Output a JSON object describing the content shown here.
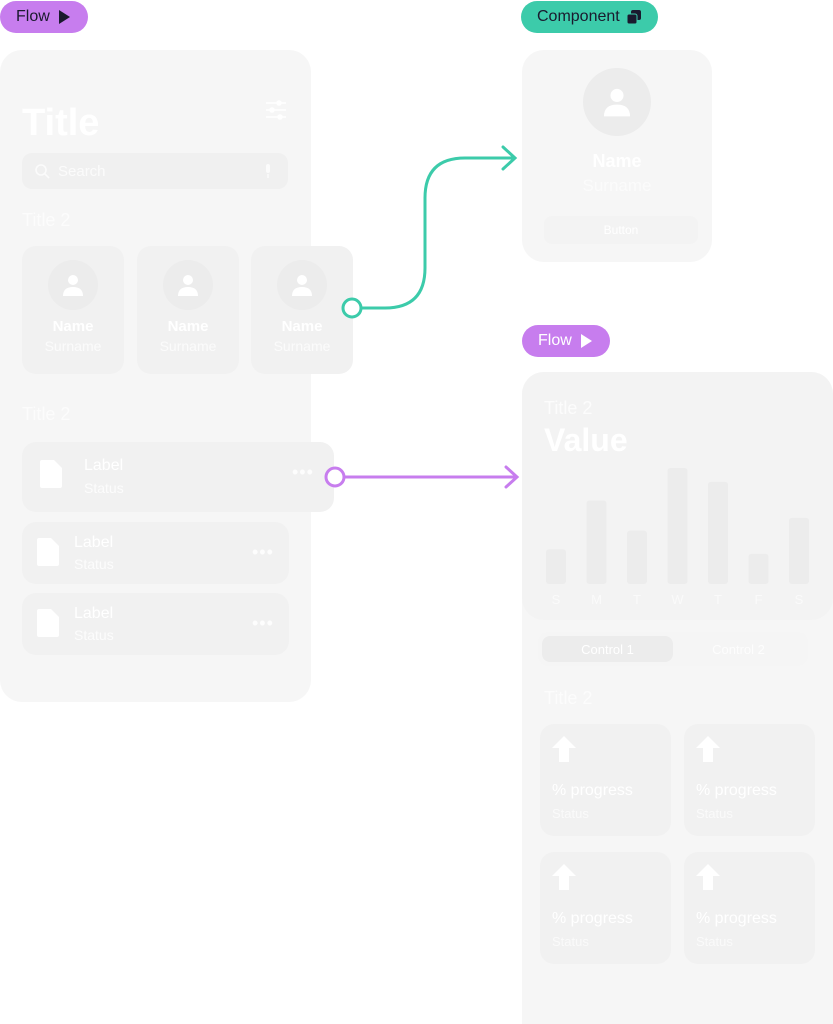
{
  "badges": {
    "flow_top": {
      "label": "Flow",
      "icon": "play-icon"
    },
    "component": {
      "label": "Component",
      "icon": "copy-icon"
    },
    "flow_bottom": {
      "label": "Flow",
      "icon": "play-icon"
    }
  },
  "colors": {
    "flow": "#c77dee",
    "component": "#3ccbaa",
    "panel": "#f6f6f6"
  },
  "left_panel": {
    "title": "Title",
    "search_placeholder": "Search",
    "people_title": "Title 2",
    "people": [
      {
        "name": "Name",
        "surname": "Surname"
      },
      {
        "name": "Name",
        "surname": "Surname"
      },
      {
        "name": "Name",
        "surname": "Surname"
      }
    ],
    "files_title": "Title 2",
    "files": [
      {
        "label": "Label",
        "status": "Status"
      },
      {
        "label": "Label",
        "status": "Status"
      },
      {
        "label": "Label",
        "status": "Status"
      }
    ]
  },
  "component_card": {
    "name": "Name",
    "surname": "Surname",
    "button_label": "Button"
  },
  "chart_panel": {
    "title": "Title 2",
    "value": "Value",
    "controls": [
      "Control 1",
      "Control 2"
    ],
    "stats_title": "Title 2",
    "stats": [
      {
        "value": "% progress",
        "status": "Status"
      },
      {
        "value": "% progress",
        "status": "Status"
      },
      {
        "value": "% progress",
        "status": "Status"
      },
      {
        "value": "% progress",
        "status": "Status"
      }
    ]
  },
  "chart_data": {
    "type": "bar",
    "title": "Title 2",
    "categories": [
      "S",
      "M",
      "T",
      "W",
      "T",
      "F",
      "S"
    ],
    "values": [
      30,
      72,
      46,
      100,
      88,
      26,
      57
    ],
    "xlabel": "",
    "ylabel": "",
    "ylim": [
      0,
      100
    ],
    "grid": false
  }
}
